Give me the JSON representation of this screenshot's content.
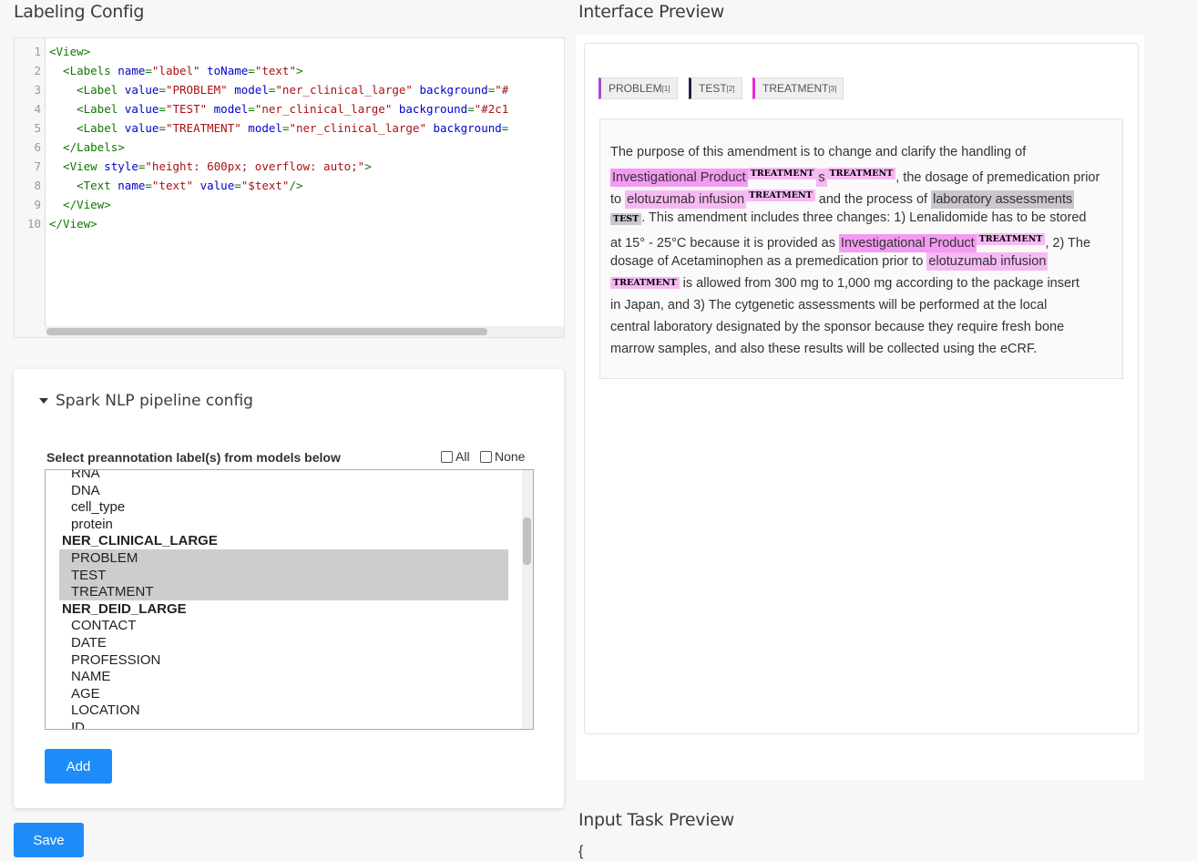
{
  "labeling_config": {
    "title": "Labeling Config",
    "line_numbers": [
      "1",
      "2",
      "3",
      "4",
      "5",
      "6",
      "7",
      "8",
      "9",
      "10"
    ],
    "lines": [
      [
        {
          "t": "tag",
          "v": "<View>"
        }
      ],
      [
        {
          "t": "tag",
          "v": "  <Labels "
        },
        {
          "t": "attr",
          "v": "name"
        },
        {
          "t": "tag",
          "v": "="
        },
        {
          "t": "str",
          "v": "\"label\""
        },
        {
          "t": "tag",
          "v": " "
        },
        {
          "t": "attr",
          "v": "toName"
        },
        {
          "t": "tag",
          "v": "="
        },
        {
          "t": "str",
          "v": "\"text\""
        },
        {
          "t": "tag",
          "v": ">"
        }
      ],
      [
        {
          "t": "tag",
          "v": "    <Label "
        },
        {
          "t": "attr",
          "v": "value"
        },
        {
          "t": "tag",
          "v": "="
        },
        {
          "t": "str",
          "v": "\"PROBLEM\""
        },
        {
          "t": "tag",
          "v": " "
        },
        {
          "t": "attr",
          "v": "model"
        },
        {
          "t": "tag",
          "v": "="
        },
        {
          "t": "str",
          "v": "\"ner_clinical_large\""
        },
        {
          "t": "tag",
          "v": " "
        },
        {
          "t": "attr",
          "v": "background"
        },
        {
          "t": "tag",
          "v": "="
        },
        {
          "t": "str",
          "v": "\"#"
        }
      ],
      [
        {
          "t": "tag",
          "v": "    <Label "
        },
        {
          "t": "attr",
          "v": "value"
        },
        {
          "t": "tag",
          "v": "="
        },
        {
          "t": "str",
          "v": "\"TEST\""
        },
        {
          "t": "tag",
          "v": " "
        },
        {
          "t": "attr",
          "v": "model"
        },
        {
          "t": "tag",
          "v": "="
        },
        {
          "t": "str",
          "v": "\"ner_clinical_large\""
        },
        {
          "t": "tag",
          "v": " "
        },
        {
          "t": "attr",
          "v": "background"
        },
        {
          "t": "tag",
          "v": "="
        },
        {
          "t": "str",
          "v": "\"#2c1"
        }
      ],
      [
        {
          "t": "tag",
          "v": "    <Label "
        },
        {
          "t": "attr",
          "v": "value"
        },
        {
          "t": "tag",
          "v": "="
        },
        {
          "t": "str",
          "v": "\"TREATMENT\""
        },
        {
          "t": "tag",
          "v": " "
        },
        {
          "t": "attr",
          "v": "model"
        },
        {
          "t": "tag",
          "v": "="
        },
        {
          "t": "str",
          "v": "\"ner_clinical_large\""
        },
        {
          "t": "tag",
          "v": " "
        },
        {
          "t": "attr",
          "v": "background"
        },
        {
          "t": "tag",
          "v": "="
        }
      ],
      [
        {
          "t": "tag",
          "v": "  </Labels>"
        }
      ],
      [
        {
          "t": "tag",
          "v": "  <View "
        },
        {
          "t": "attr",
          "v": "style"
        },
        {
          "t": "tag",
          "v": "="
        },
        {
          "t": "str",
          "v": "\"height: 600px; overflow: auto;\""
        },
        {
          "t": "tag",
          "v": ">"
        }
      ],
      [
        {
          "t": "tag",
          "v": "    <Text "
        },
        {
          "t": "attr",
          "v": "name"
        },
        {
          "t": "tag",
          "v": "="
        },
        {
          "t": "str",
          "v": "\"text\""
        },
        {
          "t": "tag",
          "v": " "
        },
        {
          "t": "attr",
          "v": "value"
        },
        {
          "t": "tag",
          "v": "="
        },
        {
          "t": "str",
          "v": "\"$text\""
        },
        {
          "t": "tag",
          "v": "/>"
        }
      ],
      [
        {
          "t": "tag",
          "v": "  </View>"
        }
      ],
      [
        {
          "t": "tag",
          "v": "</View>"
        }
      ]
    ]
  },
  "spark": {
    "header": "Spark NLP pipeline config",
    "select_label": "Select preannotation label(s) from models below",
    "all_label": "All",
    "none_label": "None",
    "options": [
      {
        "kind": "opt",
        "text": "RNA"
      },
      {
        "kind": "opt",
        "text": "DNA"
      },
      {
        "kind": "opt",
        "text": "cell_type"
      },
      {
        "kind": "opt",
        "text": "protein"
      },
      {
        "kind": "grp",
        "text": "NER_CLINICAL_LARGE"
      },
      {
        "kind": "opt",
        "text": "PROBLEM",
        "selected": true
      },
      {
        "kind": "opt",
        "text": "TEST",
        "selected": true
      },
      {
        "kind": "opt",
        "text": "TREATMENT",
        "selected": true
      },
      {
        "kind": "grp",
        "text": "NER_DEID_LARGE"
      },
      {
        "kind": "opt",
        "text": "CONTACT"
      },
      {
        "kind": "opt",
        "text": "DATE"
      },
      {
        "kind": "opt",
        "text": "PROFESSION"
      },
      {
        "kind": "opt",
        "text": "NAME"
      },
      {
        "kind": "opt",
        "text": "AGE"
      },
      {
        "kind": "opt",
        "text": "LOCATION"
      },
      {
        "kind": "opt",
        "text": "ID"
      }
    ],
    "add_label": "Add"
  },
  "save_label": "Save",
  "preview": {
    "title": "Interface Preview",
    "labels": [
      {
        "name": "PROBLEM",
        "hotkey": "[1]",
        "color": "#a64dc9"
      },
      {
        "name": "TEST",
        "hotkey": "[2]",
        "color": "#2c1e4d"
      },
      {
        "name": "TREATMENT",
        "hotkey": "[3]",
        "color": "#e52ad6"
      }
    ],
    "text_lines": [
      [
        {
          "t": "p",
          "v": "The purpose of this amendment is to change and clarify the handling of"
        }
      ],
      [
        {
          "t": "h",
          "c": "hl-t",
          "v": "Investigational Product"
        },
        {
          "t": "s",
          "v": "TREATMENT"
        },
        {
          "t": "h",
          "c": "hl-t2",
          "v": "s"
        },
        {
          "t": "s",
          "v": "TREATMENT"
        },
        {
          "t": "p",
          "v": ", the dosage of premedication prior"
        }
      ],
      [
        {
          "t": "p",
          "v": "to "
        },
        {
          "t": "h",
          "c": "hl-t2",
          "v": "elotuzumab infusion"
        },
        {
          "t": "s",
          "v": "TREATMENT"
        },
        {
          "t": "p",
          "v": " and the process of "
        },
        {
          "t": "h",
          "c": "hl-test",
          "v": "laboratory assessments"
        }
      ],
      [
        {
          "t": "st",
          "v": "TEST"
        },
        {
          "t": "p",
          "v": ". This amendment includes three changes: 1) Lenalidomide has to be stored"
        }
      ],
      [
        {
          "t": "p",
          "v": "at 15° - 25°C because it is provided as "
        },
        {
          "t": "h",
          "c": "hl-t",
          "v": "Investigational Product"
        },
        {
          "t": "s",
          "v": "TREATMENT"
        },
        {
          "t": "p",
          "v": ", 2) The"
        }
      ],
      [
        {
          "t": "p",
          "v": "dosage of Acetaminophen as a premedication prior to "
        },
        {
          "t": "h",
          "c": "hl-t2",
          "v": "elotuzumab infusion"
        }
      ],
      [
        {
          "t": "s2",
          "v": "TREATMENT"
        },
        {
          "t": "p",
          "v": " is allowed from 300 mg to 1,000 mg according to the package insert"
        }
      ],
      [
        {
          "t": "p",
          "v": "in Japan, and 3) The cytgenetic assessments will be performed at the local"
        }
      ],
      [
        {
          "t": "p",
          "v": "central laboratory designated by the sponsor because they require fresh bone"
        }
      ],
      [
        {
          "t": "p",
          "v": "marrow samples, and also these results will be collected using the eCRF."
        }
      ]
    ]
  },
  "input_task": {
    "title": "Input Task Preview",
    "first_line": "{"
  }
}
